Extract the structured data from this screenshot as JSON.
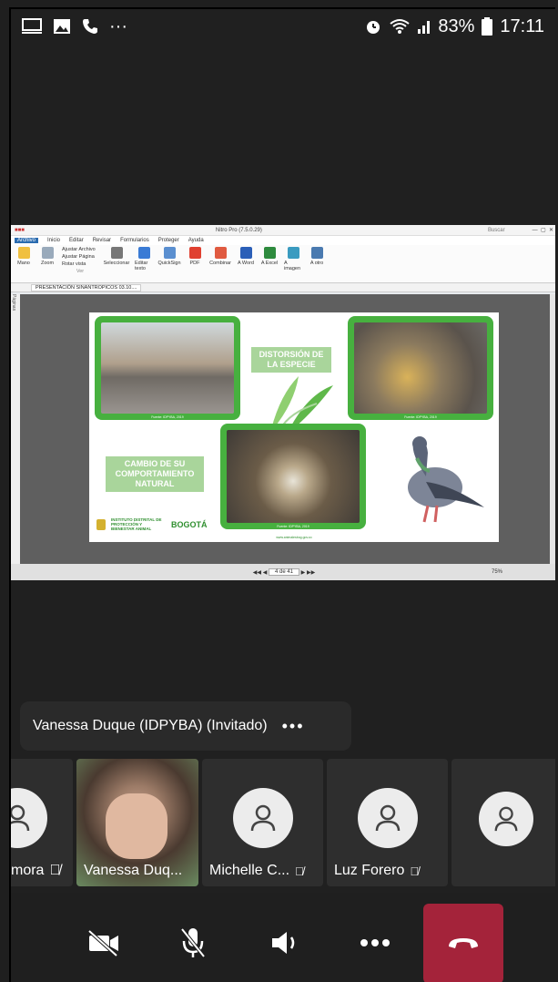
{
  "status_bar": {
    "battery": "83%",
    "time": "17:11",
    "more": "···"
  },
  "app_window": {
    "title": "Nitro Pro (7.5.0.29)",
    "search_placeholder": "Buscar",
    "menu": [
      "Archivo",
      "Inicio",
      "Editar",
      "Revisar",
      "Formularios",
      "Proteger",
      "Ayuda"
    ],
    "ribbon": {
      "mano": "Mano",
      "zoom": "Zoom",
      "ajustar_archivo": "Ajustar Archivo",
      "ajustar_pagina": "Ajustar Página",
      "rotar_vista": "Rotar vista",
      "group_ver": "Ver",
      "seleccionar": "Seleccionar",
      "editar_texto": "Editar texto",
      "quicksign": "QuickSign",
      "group_herramientas": "Herramientas",
      "pdf": "PDF",
      "combinar": "Combinar",
      "group_crear": "Crear",
      "a_word": "A Word",
      "a_excel": "A Excel",
      "a_imagen": "A imagen",
      "a_otro": "A otro",
      "group_convertir": "Convertir"
    },
    "side_tab": "Páginas",
    "doc_tab": "PRESENTACIÓN SINANTROPICOS 03.10....",
    "page_indicator": "4 de 41",
    "zoom_level": "75%"
  },
  "slide": {
    "label_distorsion": "DISTORSIÓN DE LA ESPECIE",
    "label_cambio": "CAMBIO DE SU COMPORTAMIENTO NATURAL",
    "photo_caption_1": "Fuente: IDPYBA, 2019",
    "photo_caption_2": "Fuente: IDPYBA, 2019",
    "photo_caption_3": "Fuente: IDPYBA, 2019",
    "logo_text": "INSTITUTO DISTRITAL DE PROTECCIÓN Y BIENESTAR ANIMAL",
    "bogota": "BOGOTÁ",
    "footnote": "www.animalesbog.gov.co"
  },
  "speaker": {
    "name": "Vanessa Duque (IDPYBA) (Invitado)",
    "more": "•••"
  },
  "participants": [
    {
      "name": "mora"
    },
    {
      "name": "Vanessa Duq..."
    },
    {
      "name": "Michelle C..."
    },
    {
      "name": "Luz Forero"
    }
  ],
  "colors": {
    "hangup": "#a4233a",
    "slide_green": "#47b03f",
    "label_green": "#a9d59b"
  }
}
